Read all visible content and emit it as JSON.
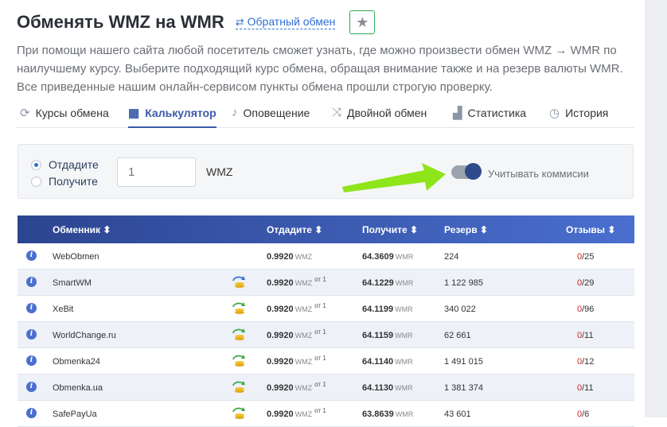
{
  "header": {
    "title": "Обменять WMZ на WMR",
    "reverse_link": "Обратный обмен",
    "reverse_icon": "swap-arrows-icon",
    "favorite_icon": "star-icon"
  },
  "description": "При помощи нашего сайта любой посетитель сможет узнать, где можно произвести обмен WMZ → WMR по наилучшему курсу. Выберите подходящий курс обмена, обращая внимание также и на резерв валюты WMR. Все приведенные нашим онлайн-сервисом пункты обмена прошли строгую проверку.",
  "tabs": [
    {
      "label": "Курсы обмена",
      "icon": "refresh-icon"
    },
    {
      "label": "Калькулятор",
      "icon": "calculator-icon"
    },
    {
      "label": "Оповещение",
      "icon": "bell-icon"
    },
    {
      "label": "Двойной обмен",
      "icon": "shuffle-icon"
    },
    {
      "label": "Статистика",
      "icon": "chart-icon"
    },
    {
      "label": "История",
      "icon": "clock-icon"
    }
  ],
  "calculator": {
    "give_label": "Отдадите",
    "get_label": "Получите",
    "selected": "give",
    "amount_placeholder": "1",
    "currency": "WMZ",
    "commission_label": "Учитывать коммисии",
    "commission_on": true
  },
  "table": {
    "headers": {
      "exchanger": "Обменник ⬍",
      "give": "Отдадите ⬍",
      "get": "Получите ⬍",
      "reserve": "Резерв ⬍",
      "reviews": "Отзывы ⬍"
    },
    "rows": [
      {
        "name": "WebObmen",
        "give": "0.9920",
        "give_unit": "WMZ",
        "min": "",
        "get": "64.3609",
        "get_unit": "WMR",
        "reserve": "224",
        "neg": "0",
        "pos": "/25",
        "icon": ""
      },
      {
        "name": "SmartWM",
        "give": "0.9920",
        "give_unit": "WMZ",
        "min": "от 1",
        "get": "64.1229",
        "get_unit": "WMR",
        "reserve": "1 122 985",
        "neg": "0",
        "pos": "/29",
        "icon": "manual-exchange-icon"
      },
      {
        "name": "XeBit",
        "give": "0.9920",
        "give_unit": "WMZ",
        "min": "от 1",
        "get": "64.1199",
        "get_unit": "WMR",
        "reserve": "340 022",
        "neg": "0",
        "pos": "/96",
        "icon": "auto-exchange-icon"
      },
      {
        "name": "WorldChange.ru",
        "give": "0.9920",
        "give_unit": "WMZ",
        "min": "от 1",
        "get": "64.1159",
        "get_unit": "WMR",
        "reserve": "62 661",
        "neg": "0",
        "pos": "/11",
        "icon": "auto-exchange-icon"
      },
      {
        "name": "Obmenka24",
        "give": "0.9920",
        "give_unit": "WMZ",
        "min": "от 1",
        "get": "64.1140",
        "get_unit": "WMR",
        "reserve": "1 491 015",
        "neg": "0",
        "pos": "/12",
        "icon": "auto-exchange-icon"
      },
      {
        "name": "Obmenka.ua",
        "give": "0.9920",
        "give_unit": "WMZ",
        "min": "от 1",
        "get": "64.1130",
        "get_unit": "WMR",
        "reserve": "1 381 374",
        "neg": "0",
        "pos": "/11",
        "icon": "auto-exchange-icon"
      },
      {
        "name": "SafePayUa",
        "give": "0.9920",
        "give_unit": "WMZ",
        "min": "от 1",
        "get": "63.8639",
        "get_unit": "WMR",
        "reserve": "43 601",
        "neg": "0",
        "pos": "/6",
        "icon": "auto-exchange-icon"
      }
    ]
  },
  "colors": {
    "accent": "#3a5aa8",
    "link": "#2f6fd3",
    "header_gradient_start": "#2c4590",
    "header_gradient_end": "#4a6fcf",
    "negative": "#d02424",
    "arrow": "#8ee51a"
  }
}
